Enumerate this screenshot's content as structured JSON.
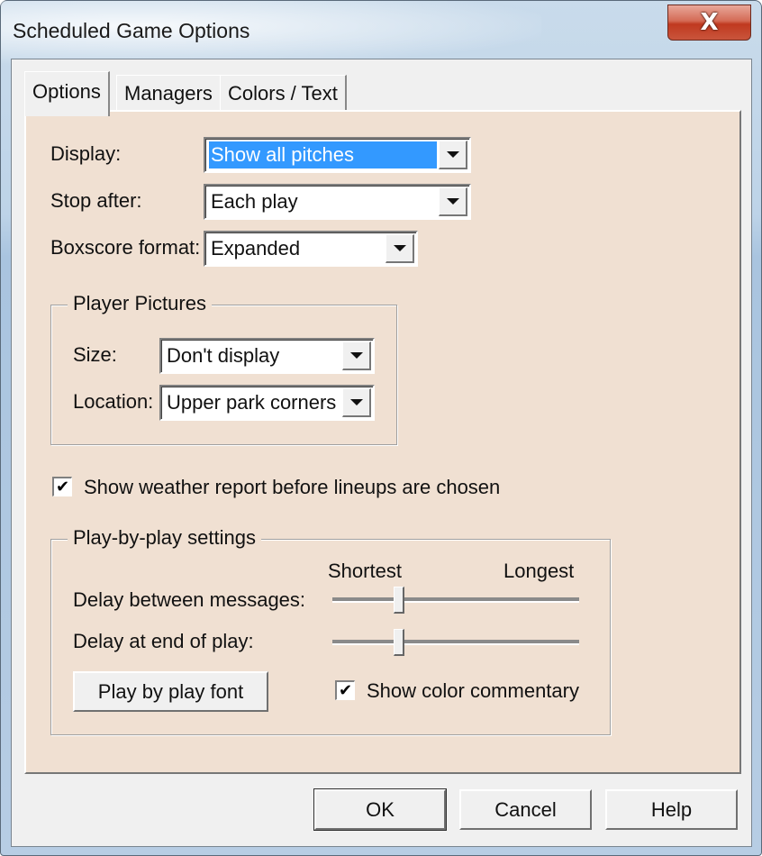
{
  "window": {
    "title": "Scheduled Game Options",
    "close_glyph": "X"
  },
  "tabs": [
    {
      "label": "Options",
      "active": true
    },
    {
      "label": "Managers",
      "active": false
    },
    {
      "label": "Colors / Text",
      "active": false
    }
  ],
  "options": {
    "display": {
      "label": "Display:",
      "value": "Show all pitches"
    },
    "stop_after": {
      "label": "Stop after:",
      "value": "Each play"
    },
    "boxscore_format": {
      "label": "Boxscore format:",
      "value": "Expanded"
    }
  },
  "player_pictures": {
    "legend": "Player Pictures",
    "size": {
      "label": "Size:",
      "value": "Don't display"
    },
    "location": {
      "label": "Location:",
      "value": "Upper park corners"
    }
  },
  "weather_checkbox": {
    "label": "Show weather report before lineups are chosen",
    "checked": true,
    "check_glyph": "✔"
  },
  "play_by_play": {
    "legend": "Play-by-play settings",
    "scale_min_label": "Shortest",
    "scale_max_label": "Longest",
    "delay_messages": {
      "label": "Delay between messages:",
      "value_percent": 27
    },
    "delay_end_play": {
      "label": "Delay at end of play:",
      "value_percent": 27
    },
    "font_button": "Play by play font",
    "color_commentary": {
      "label": "Show color commentary",
      "checked": true,
      "check_glyph": "✔"
    }
  },
  "buttons": {
    "ok": "OK",
    "cancel": "Cancel",
    "help": "Help"
  }
}
